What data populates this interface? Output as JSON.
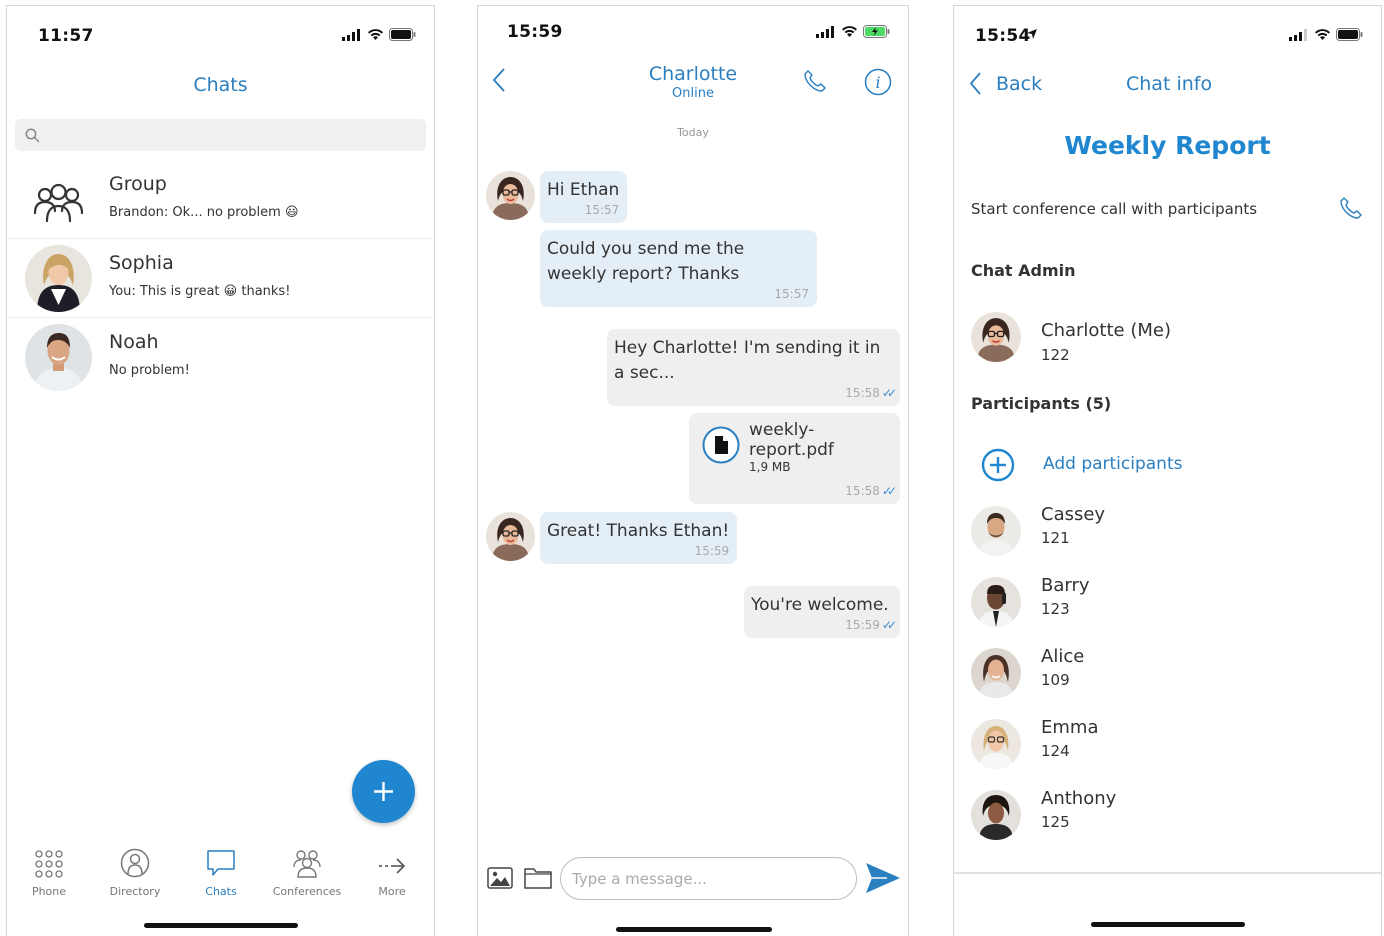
{
  "screen_chats": {
    "status_time": "11:57",
    "title": "Chats",
    "search_placeholder": "",
    "chats": [
      {
        "name": "Group",
        "last_message": "Brandon: Ok... no problem",
        "emoji": "😃"
      },
      {
        "name": "Sophia",
        "last_message_before": "You: This is great",
        "emoji": "😀",
        "last_message_after": "thanks!"
      },
      {
        "name": "Noah",
        "last_message": "No problem!"
      }
    ],
    "fab_label": "+",
    "tabs": [
      {
        "label": "Phone",
        "icon": "dialpad-icon"
      },
      {
        "label": "Directory",
        "icon": "person-circle-icon"
      },
      {
        "label": "Chats",
        "icon": "chat-bubble-icon",
        "active": true
      },
      {
        "label": "Conferences",
        "icon": "group-icon"
      },
      {
        "label": "More",
        "icon": "arrow-more-icon"
      }
    ]
  },
  "screen_conversation": {
    "status_time": "15:59",
    "contact_name": "Charlotte",
    "contact_status": "Online",
    "day_separator": "Today",
    "messages": [
      {
        "direction": "in",
        "text": "Hi Ethan",
        "time": "15:57"
      },
      {
        "direction": "in",
        "text": "Could you send me the weekly report? Thanks",
        "time": "15:57"
      },
      {
        "direction": "out",
        "text": "Hey Charlotte! I'm sending it in a sec...",
        "time": "15:58"
      },
      {
        "direction": "out",
        "file_name": "weekly-report.pdf",
        "file_size": "1,9 MB",
        "time": "15:58"
      },
      {
        "direction": "in",
        "text": "Great! Thanks Ethan!",
        "time": "15:59"
      },
      {
        "direction": "out",
        "text": "You're welcome.",
        "time": "15:59"
      }
    ],
    "input_placeholder": "Type a message..."
  },
  "screen_chat_info": {
    "status_time": "15:54",
    "back_label": "Back",
    "title": "Chat info",
    "group_name": "Weekly Report",
    "conference_text": "Start conference call with participants",
    "admin_heading": "Chat Admin",
    "admin": {
      "name": "Charlotte (Me)",
      "ext": "122"
    },
    "participants_heading": "Participants (5)",
    "add_participants_label": "Add participants",
    "participants": [
      {
        "name": "Cassey",
        "ext": "121"
      },
      {
        "name": "Barry",
        "ext": "123"
      },
      {
        "name": "Alice",
        "ext": "109"
      },
      {
        "name": "Emma",
        "ext": "124"
      },
      {
        "name": "Anthony",
        "ext": "125"
      }
    ]
  },
  "colors": {
    "accent": "#2a7fc0",
    "fab": "#1f86cf",
    "incoming_bubble": "#e4eef7",
    "outgoing_bubble": "#efefef",
    "battery_charging": "#4cd964"
  }
}
